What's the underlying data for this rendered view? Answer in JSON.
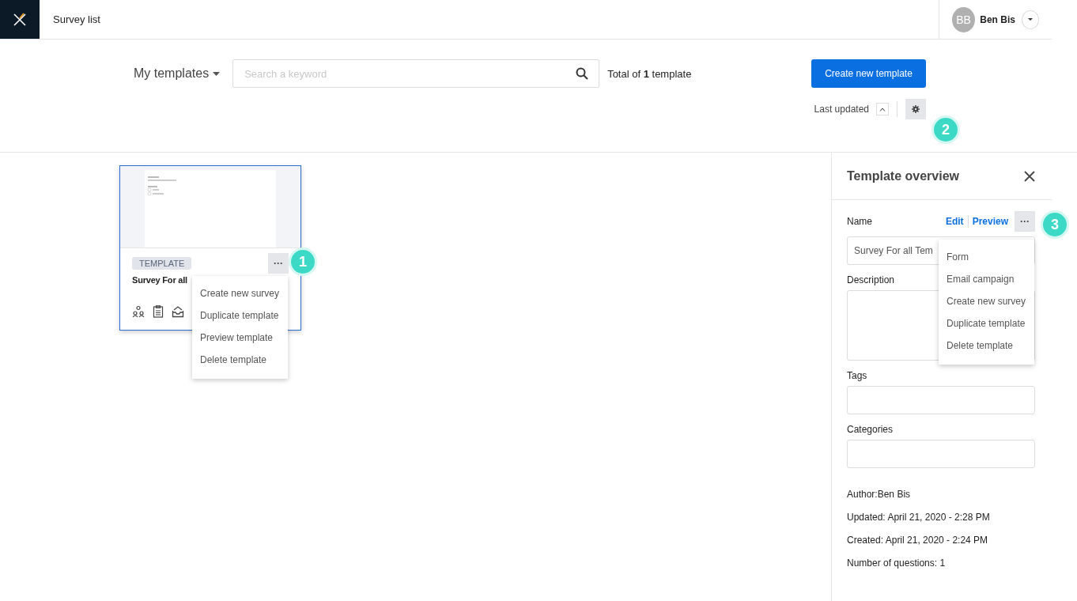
{
  "header": {
    "title": "Survey list",
    "user": {
      "initials": "BB",
      "name": "Ben Bis"
    }
  },
  "toolbar": {
    "scope": "My templates",
    "search": {
      "placeholder": "Search a keyword"
    },
    "total": "Total of **1** template",
    "create_button": "Create new template",
    "sort": {
      "label": "Last updated"
    }
  },
  "card": {
    "tag": "TEMPLATE",
    "title": "Survey For all",
    "menu": [
      "Create new survey",
      "Duplicate template",
      "Preview template",
      "Delete template"
    ]
  },
  "panel": {
    "title": "Template overview",
    "name_label": "Name",
    "edit": "Edit",
    "preview": "Preview",
    "name_value": "Survey For all Tem",
    "description_label": "Description",
    "tags_label": "Tags",
    "categories_label": "Categories",
    "menu": [
      "Form",
      "Email campaign",
      "Create new survey",
      "Duplicate template",
      "Delete template"
    ],
    "meta": [
      "Author:Ben Bis",
      "Updated: April 21, 2020 - 2:28 PM",
      "Created: April 21, 2020 - 2:24 PM",
      "Number of questions: 1"
    ]
  },
  "more_button": "···",
  "callouts": [
    "1",
    "2",
    "3"
  ]
}
